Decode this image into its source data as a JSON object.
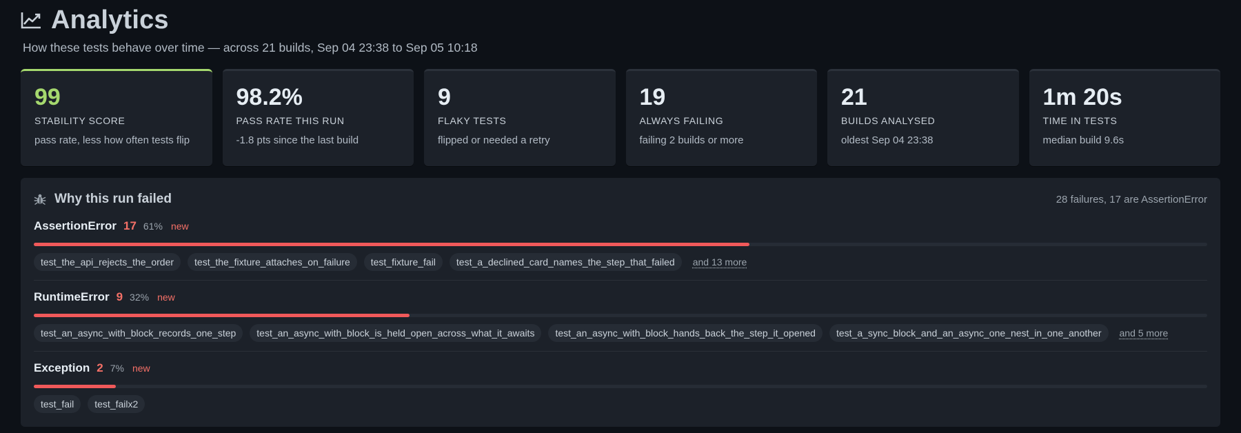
{
  "header": {
    "title": "Analytics",
    "subtitle": "How these tests behave over time — across 21 builds, Sep 04 23:38 to Sep 05 10:18",
    "icon": "chart-line-icon"
  },
  "stats": [
    {
      "value": "99",
      "label": "STABILITY SCORE",
      "hint": "pass rate, less how often tests flip",
      "accent": "#a5d86e"
    },
    {
      "value": "98.2%",
      "label": "PASS RATE THIS RUN",
      "hint": "-1.8 pts since the last build"
    },
    {
      "value": "9",
      "label": "FLAKY TESTS",
      "hint": "flipped or needed a retry"
    },
    {
      "value": "19",
      "label": "ALWAYS FAILING",
      "hint": "failing 2 builds or more"
    },
    {
      "value": "21",
      "label": "BUILDS ANALYSED",
      "hint": "oldest Sep 04 23:38"
    },
    {
      "value": "1m 20s",
      "label": "TIME IN TESTS",
      "hint": "median build 9.6s"
    }
  ],
  "failures": {
    "title": "Why this run failed",
    "icon": "bug-icon",
    "summary": "28 failures, 17 are AssertionError",
    "groups": [
      {
        "name": "AssertionError",
        "count": "17",
        "percent": "61%",
        "badge": "new",
        "fraction": 0.61,
        "tests": [
          "test_the_api_rejects_the_order",
          "test_the_fixture_attaches_on_failure",
          "test_fixture_fail",
          "test_a_declined_card_names_the_step_that_failed"
        ],
        "more": "and 13 more"
      },
      {
        "name": "RuntimeError",
        "count": "9",
        "percent": "32%",
        "badge": "new",
        "fraction": 0.32,
        "tests": [
          "test_an_async_with_block_records_one_step",
          "test_an_async_with_block_is_held_open_across_what_it_awaits",
          "test_an_async_with_block_hands_back_the_step_it_opened",
          "test_a_sync_block_and_an_async_one_nest_in_one_another"
        ],
        "more": "and 5 more"
      },
      {
        "name": "Exception",
        "count": "2",
        "percent": "7%",
        "badge": "new",
        "fraction": 0.07,
        "tests": [
          "test_fail",
          "test_failx2"
        ],
        "more": ""
      }
    ]
  },
  "colors": {
    "accent": "#a5d86e",
    "error": "#f47067",
    "bar": "#f0595a",
    "background": "#0d1117",
    "card": "#1c2129"
  }
}
